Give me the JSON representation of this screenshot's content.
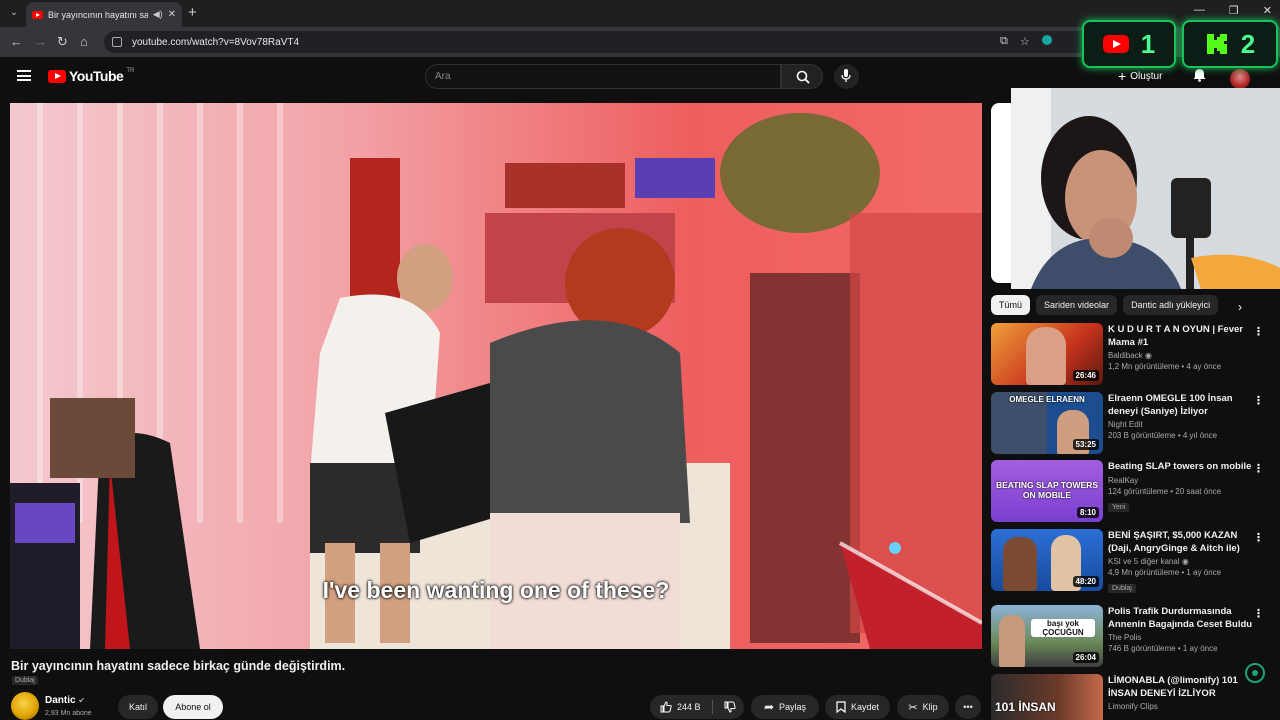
{
  "browser": {
    "tab_title": "Bir yayıncının hayatını sadece",
    "url": "youtube.com/watch?v=8Vov78RaVT4"
  },
  "header": {
    "logo_text": "YouTube",
    "country_code": "TR",
    "search_placeholder": "Ara",
    "create_label": "Oluştur"
  },
  "video": {
    "subtitle": "I've been wanting one of these?",
    "title": "Bir yayıncının hayatını sadece birkaç günde değiştirdim.",
    "dubbed_badge": "Dublaj",
    "channel": "Dantic",
    "subscribers": "2,93 Mn abone",
    "join_label": "Katıl",
    "subscribe_label": "Abone ol",
    "likes": "244 B",
    "share_label": "Paylaş",
    "save_label": "Kaydet",
    "clip_label": "Klip"
  },
  "sidebar": {
    "chips": [
      "Tümü",
      "Sariden videolar",
      "Dantic adlı yükleyici"
    ],
    "recommendations": [
      {
        "title": "K U D U R T A N OYUN | Fever Mama #1",
        "channel": "Baldiback",
        "verified": true,
        "stats": "1,2 Mn görüntüleme • 4 ay önce",
        "duration": "26:46",
        "badge": "",
        "thumb_text": ""
      },
      {
        "title": "Elraenn OMEGLE 100 İnsan deneyi (Saniye) İzliyor",
        "channel": "Night Edit",
        "verified": false,
        "stats": "203 B görüntüleme • 4 yıl önce",
        "duration": "53:25",
        "badge": "",
        "thumb_text": "OMEGLE   ELRAENN"
      },
      {
        "title": "Beating SLAP towers on mobile",
        "channel": "RealKay",
        "verified": false,
        "stats": "124 görüntüleme • 20 saat önce",
        "duration": "8:10",
        "badge": "Yeni",
        "thumb_text": "BEATING SLAP TOWERS ON MOBILE"
      },
      {
        "title": "BENİ ŞAŞIRT, $5,000 KAZAN (Daji, AngryGinge & Aitch ile)",
        "channel": "KSI ve 5 diğer kanal",
        "verified": true,
        "stats": "4,9 Mn görüntüleme • 1 ay önce",
        "duration": "48:20",
        "badge": "Dublaj",
        "thumb_text": ""
      },
      {
        "title": "Polis Trafik Durdurmasında Annenin Bagajında Ceset Buldu",
        "channel": "The Polis",
        "verified": false,
        "stats": "746 B görüntüleme • 1 ay önce",
        "duration": "26:04",
        "badge": "",
        "thumb_text": "başı yok ÇOCUĞUN"
      },
      {
        "title": "LİMONABLA (@limonify) 101 İNSAN DENEYİ İZLİYOR",
        "channel": "Limonify Clips",
        "verified": false,
        "stats": "",
        "duration": "",
        "badge": "",
        "thumb_text": "101 İNSAN"
      }
    ]
  },
  "overlay": {
    "score_youtube": "1",
    "score_kick": "2"
  },
  "colors": {
    "accent_red": "#ff0000",
    "kick_green": "#53fc18"
  }
}
